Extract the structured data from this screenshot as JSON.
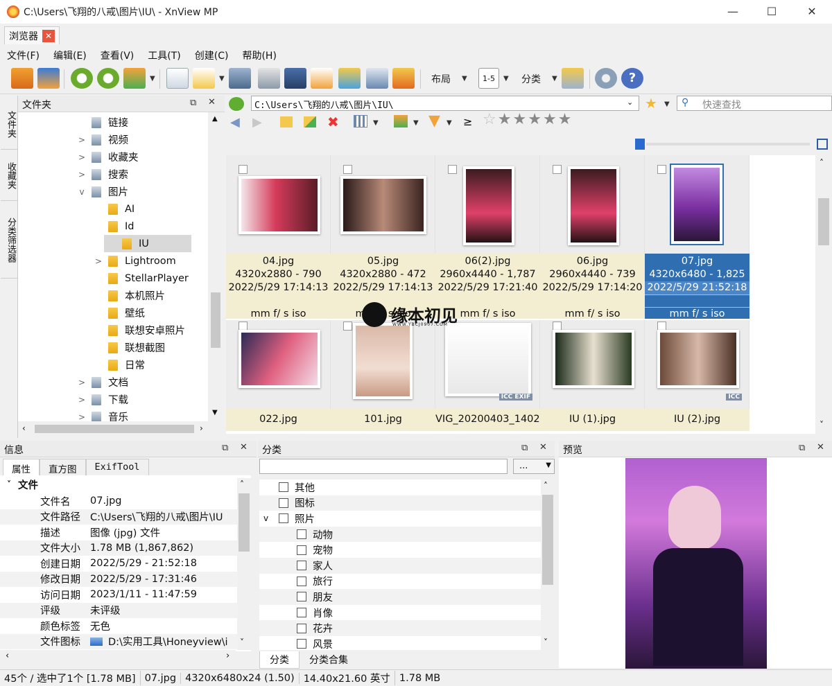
{
  "window": {
    "title": "C:\\Users\\飞翔的八戒\\图片\\IU\\ - XnView MP",
    "minimize": "—",
    "maximize": "☐",
    "close": "✕"
  },
  "tabs": [
    {
      "label": "浏览器",
      "close": "✕"
    }
  ],
  "menu": [
    "文件(F)",
    "编辑(E)",
    "查看(V)",
    "工具(T)",
    "创建(C)",
    "帮助(H)"
  ],
  "toolbar": {
    "layout_label": "布局",
    "category_label": "分类"
  },
  "folder_panel": {
    "title": "文件夹",
    "side_tabs": [
      "文件夹",
      "收藏夹",
      "分类筛选器"
    ],
    "items": [
      {
        "label": "链接",
        "expand": ""
      },
      {
        "label": "视频",
        "expand": ">"
      },
      {
        "label": "收藏夹",
        "expand": ">"
      },
      {
        "label": "搜索",
        "expand": ">"
      },
      {
        "label": "图片",
        "expand": "v"
      },
      {
        "label": "AI",
        "expand": ""
      },
      {
        "label": "Id",
        "expand": ""
      },
      {
        "label": "IU",
        "expand": ""
      },
      {
        "label": "Lightroom",
        "expand": ">"
      },
      {
        "label": "StellarPlayer",
        "expand": ""
      },
      {
        "label": "本机照片",
        "expand": ""
      },
      {
        "label": "壁纸",
        "expand": ""
      },
      {
        "label": "联想安卓照片",
        "expand": ""
      },
      {
        "label": "联想截图",
        "expand": ""
      },
      {
        "label": "日常",
        "expand": ""
      },
      {
        "label": "文档",
        "expand": ">"
      },
      {
        "label": "下载",
        "expand": ">"
      },
      {
        "label": "音乐",
        "expand": ">"
      }
    ]
  },
  "address": {
    "path": "C:\\Users\\飞翔的八戒\\图片\\IU\\",
    "search_placeholder": "快速查找"
  },
  "filter": {
    "rating_op": "≥"
  },
  "thumbnails_row1": [
    {
      "name": "04.jpg",
      "dims": "4320x2880 - 790",
      "date": "2022/5/29 17:14:13",
      "exif": "mm f/ s iso"
    },
    {
      "name": "05.jpg",
      "dims": "4320x2880 - 472",
      "date": "2022/5/29 17:14:13",
      "exif": "mm f/ s iso"
    },
    {
      "name": "06(2).jpg",
      "dims": "2960x4440 - 1,787",
      "date": "2022/5/29 17:21:40",
      "exif": "mm f/ s iso"
    },
    {
      "name": "06.jpg",
      "dims": "2960x4440 - 739",
      "date": "2022/5/29 17:14:20",
      "exif": "mm f/ s iso"
    },
    {
      "name": "07.jpg",
      "dims": "4320x6480 - 1,825",
      "date": "2022/5/29 21:52:18",
      "exif": "mm f/ s iso"
    }
  ],
  "thumbnails_row2": [
    {
      "name": "022.jpg",
      "badge": ""
    },
    {
      "name": "101.jpg",
      "badge": ""
    },
    {
      "name": "VIG_20200403_1402.",
      "badge": "ICC EXIF"
    },
    {
      "name": "IU (1).jpg",
      "badge": ""
    },
    {
      "name": "IU (2).jpg",
      "badge": "ICC"
    }
  ],
  "watermark": {
    "text": "缘本初见",
    "sub": "WWW.YBCJ0907.COM"
  },
  "info_panel": {
    "title": "信息",
    "tabs": [
      "属性",
      "直方图",
      "ExifTool"
    ],
    "section": "文件",
    "rows": [
      {
        "k": "文件名",
        "v": "07.jpg"
      },
      {
        "k": "文件路径",
        "v": "C:\\Users\\飞翔的八戒\\图片\\IU"
      },
      {
        "k": "描述",
        "v": "图像 (jpg) 文件"
      },
      {
        "k": "文件大小",
        "v": "1.78 MB (1,867,862)"
      },
      {
        "k": "创建日期",
        "v": "2022/5/29 - 21:52:18"
      },
      {
        "k": "修改日期",
        "v": "2022/5/29 - 17:31:46"
      },
      {
        "k": "访问日期",
        "v": "2023/1/11 - 11:47:59"
      },
      {
        "k": "评级",
        "v": "未评级"
      },
      {
        "k": "颜色标签",
        "v": "无色"
      },
      {
        "k": "文件图标",
        "v": "D:\\实用工具\\Honeyview\\i"
      }
    ]
  },
  "category_panel": {
    "title": "分类",
    "more_button": "...",
    "items": [
      {
        "label": "其他",
        "level": 0,
        "expand": ""
      },
      {
        "label": "图标",
        "level": 0,
        "expand": ""
      },
      {
        "label": "照片",
        "level": 0,
        "expand": "v"
      },
      {
        "label": "动物",
        "level": 1,
        "expand": ""
      },
      {
        "label": "宠物",
        "level": 1,
        "expand": ""
      },
      {
        "label": "家人",
        "level": 1,
        "expand": ""
      },
      {
        "label": "旅行",
        "level": 1,
        "expand": ""
      },
      {
        "label": "朋友",
        "level": 1,
        "expand": ""
      },
      {
        "label": "肖像",
        "level": 1,
        "expand": ""
      },
      {
        "label": "花卉",
        "level": 1,
        "expand": ""
      },
      {
        "label": "风景",
        "level": 1,
        "expand": ""
      }
    ],
    "bottom_tabs": [
      "分类",
      "分类合集"
    ]
  },
  "preview_panel": {
    "title": "预览"
  },
  "statusbar": {
    "count": "45个 / 选中了1个 [1.78 MB]",
    "file": "07.jpg",
    "dims": "4320x6480x24 (1.50)",
    "size_in": "14.40x21.60 英寸",
    "size": "1.78 MB"
  }
}
